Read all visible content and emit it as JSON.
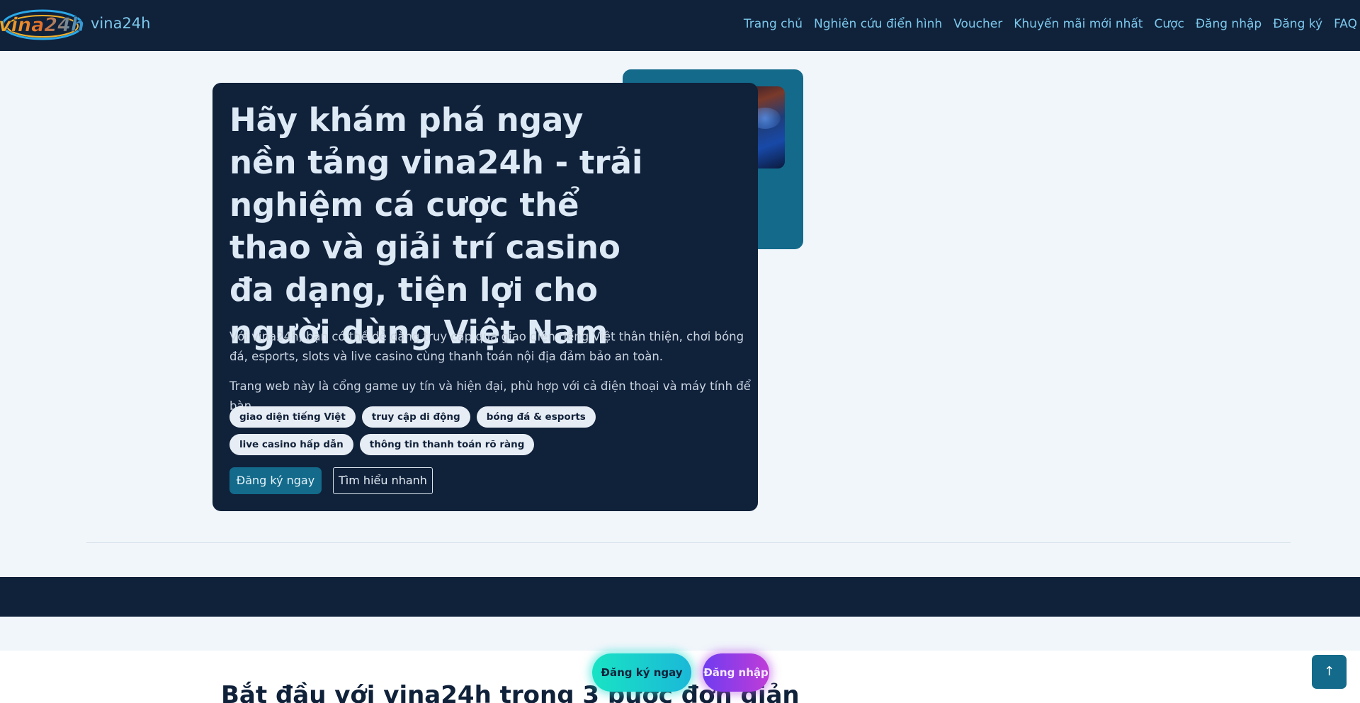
{
  "header": {
    "logo_text": "vina24h",
    "brand": "vina24h",
    "nav": [
      "Trang chủ",
      "Nghiên cứu điển hình",
      "Voucher",
      "Khuyến mãi mới nhất",
      "Cược",
      "Đăng nhập",
      "Đăng ký",
      "FAQ"
    ]
  },
  "hero": {
    "title": "Hãy khám phá ngay nền tảng vina24h - trải nghiệm cá cược thể thao và giải trí casino đa dạng, tiện lợi cho người dùng Việt Nam",
    "paragraph1": "Với vina24h, bạn có thể dễ dàng truy cập qua giao diện tiếng Việt thân thiện, chơi bóng đá, esports, slots và live casino cùng thanh toán nội địa đảm bảo an toàn.",
    "paragraph2": "Trang web này là cổng game uy tín và hiện đại, phù hợp với cả điện thoại và máy tính để bàn.",
    "tags": [
      "giao diện tiếng Việt",
      "truy cập di động",
      "bóng đá & esports",
      "live casino hấp dẫn",
      "thông tin thanh toán rõ ràng"
    ],
    "primary_button": "Đăng ký ngay",
    "secondary_button": "Tìm hiểu nhanh"
  },
  "section": {
    "heading": "Bắt đầu với vina24h trong 3 bước đơn giản"
  },
  "floating": {
    "register": "Đăng ký ngay",
    "login": "Đăng nhập",
    "to_top_icon": "arrow-up-icon"
  },
  "colors": {
    "header_bg": "#10213a",
    "accent": "#136a8a",
    "nav_link": "#7cc9ec",
    "page_bg": "#f1f6fb"
  }
}
